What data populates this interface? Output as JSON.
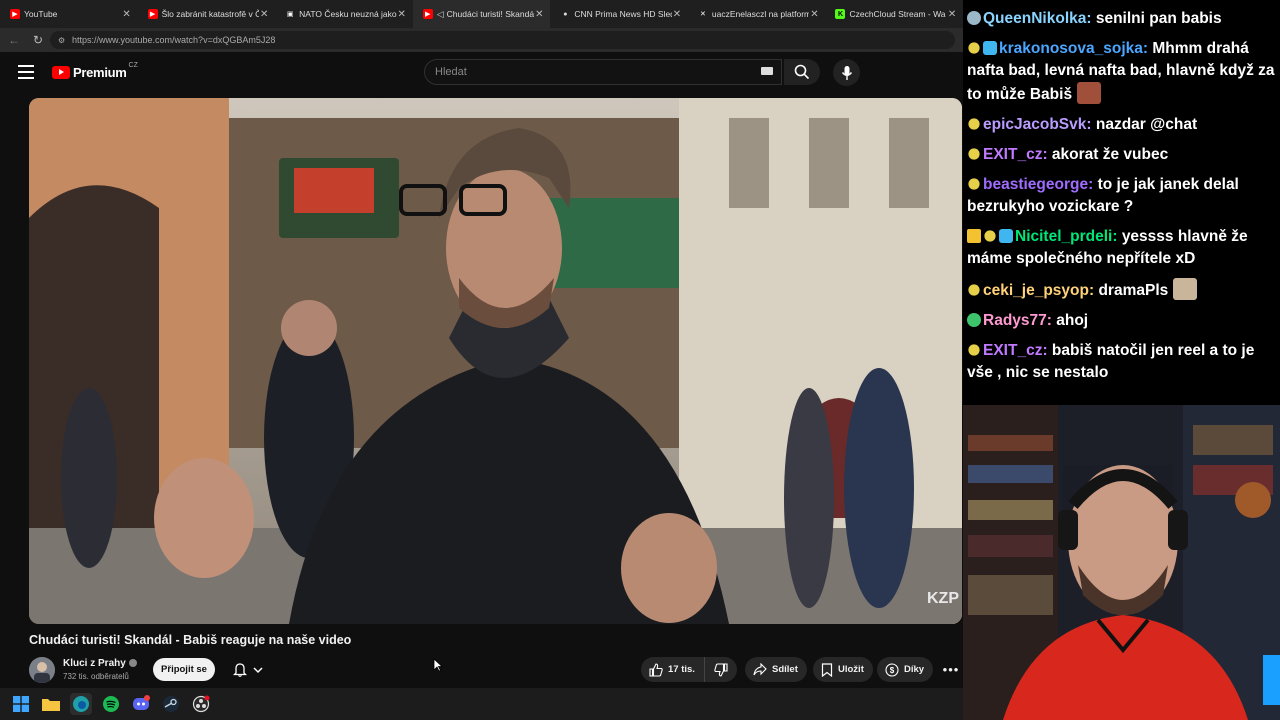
{
  "browser": {
    "tabs": [
      {
        "title": "YouTube",
        "icon": "youtube-icon",
        "color": "#ff0000",
        "active": false
      },
      {
        "title": "Šlo zabránit katastrofě v Čern",
        "icon": "youtube-icon",
        "color": "#ff0000",
        "active": false
      },
      {
        "title": "NATO Česku neuzná jako ú",
        "icon": "news-icon",
        "color": "#ffffff",
        "active": false
      },
      {
        "title": "Chudáci turisti! Skandál",
        "icon": "youtube-icon",
        "color": "#ff0000",
        "active": true
      },
      {
        "title": "CNN Prima News HD Sleduj",
        "icon": "cnn-icon",
        "color": "#dddddd",
        "active": false
      },
      {
        "title": "uaczEnelasczl na platformě X",
        "icon": "x-icon",
        "color": "#ffffff",
        "active": false
      },
      {
        "title": "CzechCloud Stream - Wa",
        "icon": "kick-icon",
        "color": "#53fc18",
        "active": false
      }
    ],
    "url": "https://www.youtube.com/watch?v=dxQGBAm5J28"
  },
  "youtube": {
    "logo_text": "Premium",
    "logo_region": "CZ",
    "search_placeholder": "Hledat",
    "video_title": "Chudáci turisti! Skandál - Babiš reaguje na naše video",
    "channel_name": "Kluci z Prahy",
    "subscribers": "732 tis. odběratelů",
    "join_label": "Připojit se",
    "likes": "17 tis.",
    "share_label": "Sdílet",
    "save_label": "Uložit",
    "thanks_label": "Díky",
    "watermark": "KZP"
  },
  "chat": [
    {
      "user": "QueenNikolka",
      "color": "#8ad4ff",
      "badges": [
        "bits-icon"
      ],
      "text": "senilni pan babis",
      "emote": null
    },
    {
      "user": "krakonosova_sojka",
      "color": "#4ba6ff",
      "badges": [
        "sub-badge-icon",
        "gem-icon"
      ],
      "text": "Mhmm drahá nafta bad, levná nafta bad, hlavně když za to může Babiš",
      "emote": "babis-emote"
    },
    {
      "user": "epicJacobSvk",
      "color": "#b99cff",
      "badges": [
        "sub-badge-icon"
      ],
      "text": "nazdar @chat",
      "emote": null
    },
    {
      "user": "EXIT_cz",
      "color": "#c07aff",
      "badges": [
        "sub-badge-icon"
      ],
      "text": "akorat že vubec",
      "emote": null
    },
    {
      "user": "beastiegeorge",
      "color": "#a06bff",
      "badges": [
        "sub-badge-icon"
      ],
      "text": "to je jak janek delal bezrukyho vozickare ?",
      "emote": null
    },
    {
      "user": "Nicitel_prdeli",
      "color": "#00e676",
      "badges": [
        "crown-icon",
        "sub-badge-icon",
        "gem-icon"
      ],
      "text": "yessss hlavně že máme společného nepřítele xD",
      "emote": null
    },
    {
      "user": "ceki_je_psyop",
      "color": "#ffd27a",
      "badges": [
        "sub-badge-icon"
      ],
      "text": "dramaPls",
      "emote": "dancing-emote"
    },
    {
      "user": "Radys77",
      "color": "#ff9ad1",
      "badges": [
        "gift-badge-icon"
      ],
      "text": "ahoj",
      "emote": null
    },
    {
      "user": "EXIT_cz",
      "color": "#c07aff",
      "badges": [
        "sub-badge-icon"
      ],
      "text": "babiš natočil jen reel a to je vše , nic se nestalo",
      "emote": null
    }
  ]
}
